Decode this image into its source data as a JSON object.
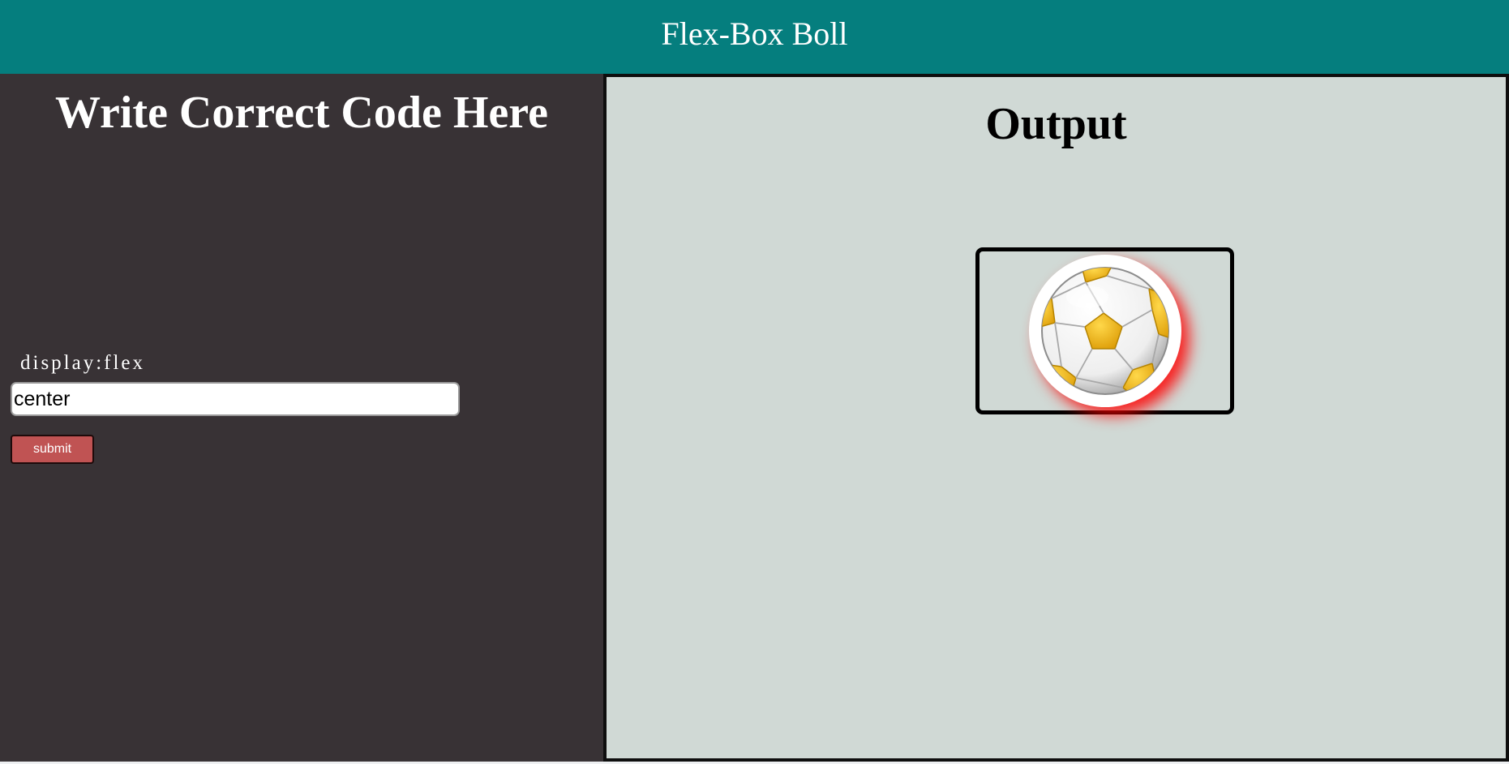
{
  "header": {
    "title": "Flex-Box Boll"
  },
  "editor": {
    "heading": "Write Correct Code Here",
    "code_label": "display:flex",
    "input_value": "center",
    "submit_label": "submit"
  },
  "output": {
    "heading": "Output"
  },
  "colors": {
    "header_bg": "#057e7e",
    "left_panel_bg": "#383235",
    "right_panel_bg": "#d0d9d5",
    "submit_bg": "#c05353",
    "ball_shadow": "#ff0000",
    "ball_yellow": "#f2b40f"
  },
  "icons": {
    "ball": "soccer-ball-icon"
  }
}
